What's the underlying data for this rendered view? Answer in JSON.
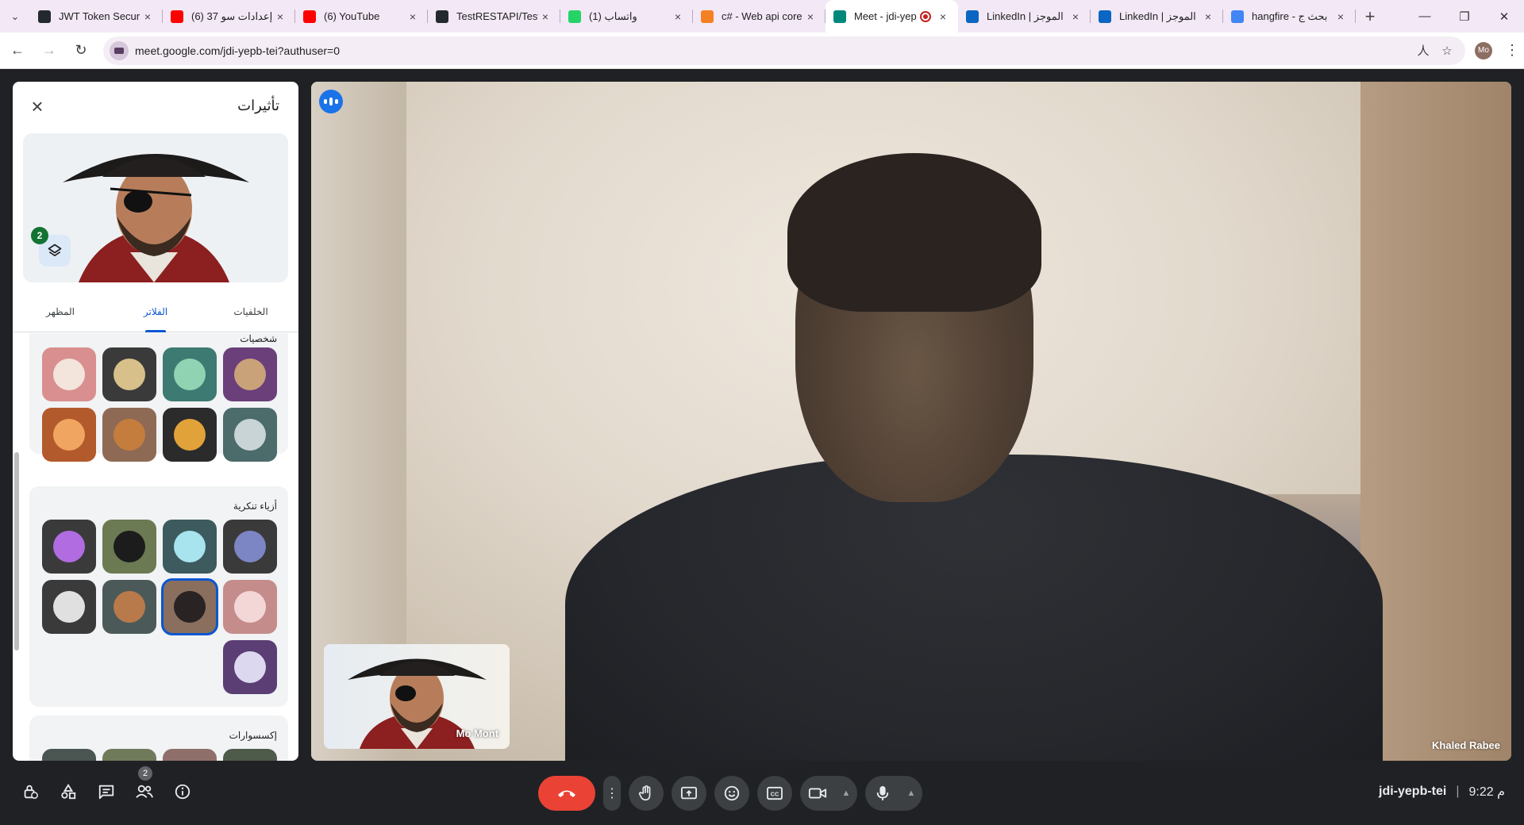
{
  "browser": {
    "tabs": [
      {
        "title": "JWT Token Securit",
        "favicon": "github-style",
        "color": "#24292f"
      },
      {
        "title": "(6) 37 إعدادات سو",
        "favicon": "youtube",
        "color": "#ff0000"
      },
      {
        "title": "(6) YouTube",
        "favicon": "youtube",
        "color": "#ff0000"
      },
      {
        "title": "TestRESTAPI/TestR",
        "favicon": "github",
        "color": "#24292f"
      },
      {
        "title": "(1) واتساب",
        "favicon": "whatsapp",
        "color": "#25d366"
      },
      {
        "title": "c# - Web api core",
        "favicon": "stackoverflow",
        "color": "#f48024"
      },
      {
        "title": "Meet - jdi-yep",
        "favicon": "google-meet",
        "color": "#00897b",
        "active": true
      },
      {
        "title": "LinkedIn | الموجز",
        "favicon": "linkedin",
        "color": "#0a66c2"
      },
      {
        "title": "LinkedIn | الموجز",
        "favicon": "linkedin",
        "color": "#0a66c2"
      },
      {
        "title": "hangfire - بحث ج",
        "favicon": "google",
        "color": "#4285f4"
      }
    ],
    "url": "meet.google.com/jdi-yepb-tei?authuser=0",
    "profile_initials": "Mo"
  },
  "effects": {
    "title": "تأثيرات",
    "layers_count": "2",
    "tabs": [
      {
        "label": "المظهر"
      },
      {
        "label": "الفلاتر",
        "active": true
      },
      {
        "label": "الخلفيات"
      }
    ],
    "sections": [
      {
        "title": "شخصيات",
        "items": [
          {
            "name": "owl",
            "bg": "#6a3f7a",
            "fg": "#c9a27a"
          },
          {
            "name": "alien",
            "bg": "#3d7a72",
            "fg": "#8fd3b3"
          },
          {
            "name": "pufferfish",
            "bg": "#3a3a3a",
            "fg": "#d7c08a"
          },
          {
            "name": "bunny",
            "bg": "#d98f8f",
            "fg": "#f3e4dc"
          },
          {
            "name": "robot",
            "bg": "#4c6b6b",
            "fg": "#c9d4d6"
          },
          {
            "name": "chicken",
            "bg": "#2b2b2b",
            "fg": "#e2a23a"
          },
          {
            "name": "puppy",
            "bg": "#8e6a55",
            "fg": "#c47d3c"
          },
          {
            "name": "cat",
            "bg": "#b35a2c",
            "fg": "#f0a560"
          }
        ]
      },
      {
        "title": "أزياء تنكرية",
        "items": [
          {
            "name": "wizard-hat",
            "bg": "#3a3a3a",
            "fg": "#7c86c4"
          },
          {
            "name": "astronaut-helmet",
            "bg": "#3d5a5e",
            "fg": "#a7e4ee"
          },
          {
            "name": "sunglasses",
            "bg": "#6b7a52",
            "fg": "#1c1c1c"
          },
          {
            "name": "rainbow-wig",
            "bg": "#3a3a3a",
            "fg": "#b06ce0"
          },
          {
            "name": "bunny-ears",
            "bg": "#c58c8c",
            "fg": "#f3d6d6"
          },
          {
            "name": "pirate-hat",
            "bg": "#8a6f5e",
            "fg": "#2a2323",
            "selected": true
          },
          {
            "name": "cowboy-hat",
            "bg": "#4b5a58",
            "fg": "#b87a4b"
          },
          {
            "name": "fedora",
            "bg": "#3a3a3a",
            "fg": "#e0e0e0"
          },
          {
            "name": "space-mascot",
            "bg": "#5a3e74",
            "fg": "#dcd8f0"
          }
        ]
      },
      {
        "title": "إكسسوارات"
      }
    ]
  },
  "meeting": {
    "main_participant": "Khaled Rabee",
    "self_participant": "Mo Mont",
    "people_count": "2",
    "code": "jdi-yepb-tei",
    "time": "9:22 م"
  }
}
